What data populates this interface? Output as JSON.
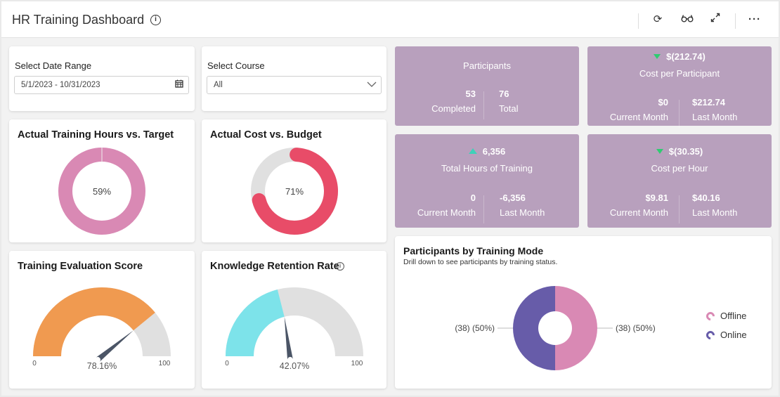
{
  "header": {
    "title": "HR Training Dashboard",
    "icons": [
      "refresh-icon",
      "glasses-icon",
      "expand-icon",
      "more-icon"
    ]
  },
  "filters": {
    "date_range": {
      "label": "Select Date Range",
      "value": "5/1/2023 - 10/31/2023"
    },
    "course": {
      "label": "Select Course",
      "value": "All"
    }
  },
  "gauges": {
    "training_hours": {
      "title": "Actual Training Hours vs. Target",
      "value_label": "59%",
      "value": 59,
      "color": "#d989b4",
      "track": "#e0e0e0"
    },
    "cost_budget": {
      "title": "Actual Cost vs. Budget",
      "value_label": "71%",
      "value": 71,
      "color": "#e84c68",
      "track": "#e0e0e0"
    },
    "evaluation": {
      "title": "Training Evaluation Score",
      "value_label": "78.16%",
      "value": 78.16,
      "min": "0",
      "max": "100",
      "color": "#f09a50",
      "track": "#e0e0e0"
    },
    "retention": {
      "title": "Knowledge Retention Rate",
      "value_label": "42.07%",
      "value": 42.07,
      "min": "0",
      "max": "100",
      "color": "#7de3ea",
      "track": "#e0e0e0"
    }
  },
  "kpis": {
    "participants": {
      "title": "Participants",
      "left_value": "53",
      "left_label": "Completed",
      "right_value": "76",
      "right_label": "Total"
    },
    "cost_per_participant": {
      "trend": "down",
      "delta": "$(212.74)",
      "title": "Cost per Participant",
      "left_value": "$0",
      "left_label": "Current Month",
      "right_value": "$212.74",
      "right_label": "Last Month"
    },
    "total_hours": {
      "trend": "up",
      "delta": "6,356",
      "title": "Total Hours of Training",
      "left_value": "0",
      "left_label": "Current Month",
      "right_value": "-6,356",
      "right_label": "Last Month"
    },
    "cost_per_hour": {
      "trend": "down",
      "delta": "$(30.35)",
      "title": "Cost per Hour",
      "left_value": "$9.81",
      "left_label": "Current Month",
      "right_value": "$40.16",
      "right_label": "Last Month"
    }
  },
  "participants_by_mode": {
    "title": "Participants by Training Mode",
    "subtitle": "Drill down to see participants by training status."
  },
  "chart_data": {
    "type": "pie",
    "title": "Participants by Training Mode",
    "series": [
      {
        "name": "Offline",
        "value": 38,
        "percent": 50,
        "label": "(38) (50%)",
        "color": "#d989b4"
      },
      {
        "name": "Online",
        "value": 38,
        "percent": 50,
        "label": "(38) (50%)",
        "color": "#675ca9"
      }
    ],
    "legend": "right"
  }
}
